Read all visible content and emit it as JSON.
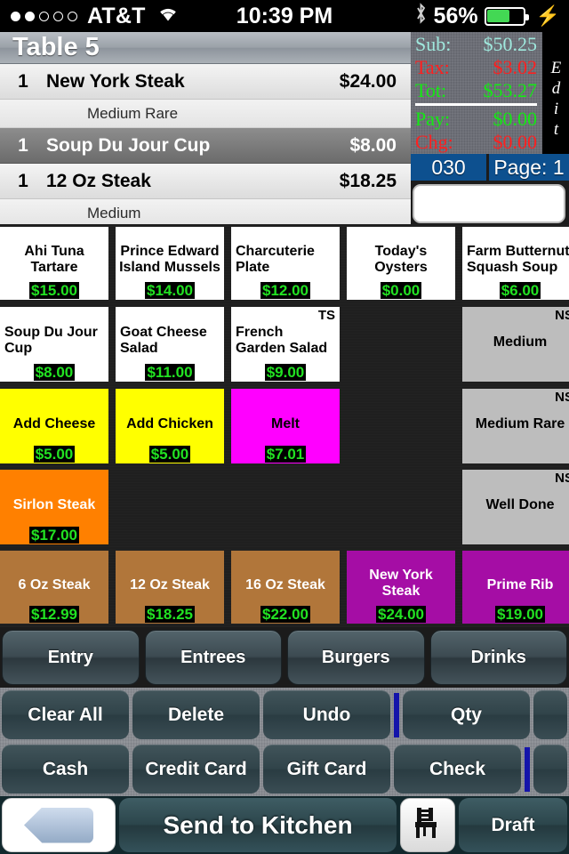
{
  "status_bar": {
    "carrier": "AT&T",
    "signal_dots_filled": 2,
    "signal_dots_total": 5,
    "wifi_icon": "wifi-icon",
    "time": "10:39 PM",
    "bluetooth_icon": "bluetooth-icon",
    "battery_percent": "56%",
    "battery_fill": 56,
    "charging_icon": "lightning-bolt-icon"
  },
  "order": {
    "title": "Table 5",
    "rows": [
      {
        "qty": "1",
        "name": "New York Steak",
        "price": "$24.00",
        "selected": false,
        "modifier": "Medium Rare"
      },
      {
        "qty": "1",
        "name": "Soup Du Jour Cup",
        "price": "$8.00",
        "selected": true,
        "modifier": null
      },
      {
        "qty": "1",
        "name": "12 Oz Steak",
        "price": "$18.25",
        "selected": false,
        "modifier": "Medium"
      }
    ]
  },
  "totals": {
    "sub_label": "Sub:",
    "sub_value": "$50.25",
    "sub_color": "#9fe8dd",
    "tax_label": "Tax:",
    "tax_value": "$3.02",
    "tax_color": "#ff1f1f",
    "tot_label": "Tot:",
    "tot_value": "$53.27",
    "tot_color": "#14e814",
    "pay_label": "Pay:",
    "pay_value": "$0.00",
    "pay_color": "#14e814",
    "chg_label": "Chg:",
    "chg_value": "$0.00",
    "chg_color": "#ff1f1f",
    "edit_label": "Edit",
    "counter": "030",
    "page": "Page: 1",
    "entry_value": ""
  },
  "menu_grid": {
    "columns": 5,
    "rows": 5,
    "cells": [
      {
        "label": "Ahi Tuna Tartare",
        "price": "$15.00",
        "style": "c-white",
        "badge": "",
        "center": true
      },
      {
        "label": "Prince Edward Island Mussels",
        "price": "$14.00",
        "style": "c-white",
        "badge": "",
        "center": true
      },
      {
        "label": "Charcuterie Plate",
        "price": "$12.00",
        "style": "c-white",
        "badge": "",
        "center": false
      },
      {
        "label": "Today's Oysters",
        "price": "$0.00",
        "style": "c-white",
        "badge": "",
        "center": true
      },
      {
        "label": "Farm Butternut Squash Soup",
        "price": "$6.00",
        "style": "c-white",
        "badge": "",
        "center": false
      },
      {
        "label": "Soup Du Jour Cup",
        "price": "$8.00",
        "style": "c-white",
        "badge": "",
        "center": false
      },
      {
        "label": "Goat Cheese Salad",
        "price": "$11.00",
        "style": "c-white",
        "badge": "",
        "center": false
      },
      {
        "label": "French Garden Salad",
        "price": "$9.00",
        "style": "c-white",
        "badge": "TS",
        "center": false
      },
      {
        "label": "",
        "price": "",
        "style": "empty",
        "badge": "",
        "center": false
      },
      {
        "label": "Medium",
        "price": "",
        "style": "c-gray",
        "badge": "NS",
        "center": true
      },
      {
        "label": "Add Cheese",
        "price": "$5.00",
        "style": "c-yellow",
        "badge": "",
        "center": true
      },
      {
        "label": "Add Chicken",
        "price": "$5.00",
        "style": "c-yellow",
        "badge": "",
        "center": true
      },
      {
        "label": "Melt",
        "price": "$7.01",
        "style": "c-magenta",
        "badge": "",
        "center": true
      },
      {
        "label": "",
        "price": "",
        "style": "empty",
        "badge": "",
        "center": false
      },
      {
        "label": "Medium Rare",
        "price": "",
        "style": "c-gray",
        "badge": "NS",
        "center": true
      },
      {
        "label": "Sirlon Steak",
        "price": "$17.00",
        "style": "c-orange",
        "badge": "",
        "center": true
      },
      {
        "label": "",
        "price": "",
        "style": "empty",
        "badge": "",
        "center": false
      },
      {
        "label": "",
        "price": "",
        "style": "empty",
        "badge": "",
        "center": false
      },
      {
        "label": "",
        "price": "",
        "style": "empty",
        "badge": "",
        "center": false
      },
      {
        "label": "Well Done",
        "price": "",
        "style": "c-gray",
        "badge": "NS",
        "center": true
      },
      {
        "label": "6 Oz Steak",
        "price": "$12.99",
        "style": "c-brown",
        "badge": "",
        "center": true
      },
      {
        "label": "12 Oz Steak",
        "price": "$18.25",
        "style": "c-brown",
        "badge": "",
        "center": true
      },
      {
        "label": "16 Oz Steak",
        "price": "$22.00",
        "style": "c-brown",
        "badge": "",
        "center": true
      },
      {
        "label": "New York Steak",
        "price": "$24.00",
        "style": "c-purple",
        "badge": "",
        "center": true
      },
      {
        "label": "Prime Rib",
        "price": "$19.00",
        "style": "c-purple",
        "badge": "",
        "center": true
      }
    ]
  },
  "category_tabs": [
    {
      "label": "Entry"
    },
    {
      "label": "Entrees"
    },
    {
      "label": "Burgers"
    },
    {
      "label": "Drinks"
    }
  ],
  "edit_row": [
    {
      "label": "Clear All"
    },
    {
      "label": "Delete"
    },
    {
      "label": "Undo"
    },
    {
      "label": "Qty"
    },
    {
      "label": ""
    }
  ],
  "payment_row": [
    {
      "label": "Cash"
    },
    {
      "label": "Credit Card"
    },
    {
      "label": "Gift Card"
    },
    {
      "label": "Check"
    },
    {
      "label": ""
    }
  ],
  "bottom_bar": {
    "back_icon": "back-arrow-icon",
    "send_label": "Send to Kitchen",
    "seat_icon": "chair-icon",
    "draft_label": "Draft"
  },
  "colors": {
    "accent_blue": "#0d508f",
    "divider_blue": "#1414aa",
    "price_green": "#22e222",
    "button_teal": "#31444a"
  }
}
